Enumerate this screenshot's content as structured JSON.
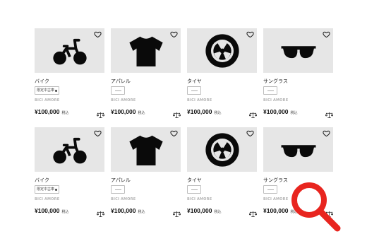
{
  "products": [
    {
      "icon": "bicycle-icon",
      "name": "バイク",
      "badge": "限定中古車",
      "badge_type": "tag",
      "brand": "BICI AMORE",
      "price": "¥100,000",
      "tax": "税込"
    },
    {
      "icon": "tshirt-icon",
      "name": "アパレル",
      "badge": "",
      "badge_type": "placeholder",
      "brand": "BICI AMORE",
      "price": "¥100,000",
      "tax": "税込"
    },
    {
      "icon": "tire-icon",
      "name": "タイヤ",
      "badge": "",
      "badge_type": "placeholder",
      "brand": "BICI AMORE",
      "price": "¥100,000",
      "tax": "税込"
    },
    {
      "icon": "sunglasses-icon",
      "name": "サングラス",
      "badge": "",
      "badge_type": "placeholder",
      "brand": "BICI AMORE",
      "price": "¥100,000",
      "tax": "税込"
    },
    {
      "icon": "bicycle-icon",
      "name": "バイク",
      "badge": "限定中古車",
      "badge_type": "tag",
      "brand": "BICI AMORE",
      "price": "¥100,000",
      "tax": "税込"
    },
    {
      "icon": "tshirt-icon",
      "name": "アパレル",
      "badge": "",
      "badge_type": "placeholder",
      "brand": "BICI AMORE",
      "price": "¥100,000",
      "tax": "税込"
    },
    {
      "icon": "tire-icon",
      "name": "タイヤ",
      "badge": "",
      "badge_type": "placeholder",
      "brand": "BICI AMORE",
      "price": "¥100,000",
      "tax": "税込"
    },
    {
      "icon": "sunglasses-icon",
      "name": "サングラス",
      "badge": "",
      "badge_type": "placeholder",
      "brand": "BICI AMORE",
      "price": "¥100,000",
      "tax": "税込"
    }
  ],
  "colors": {
    "thumb_bg": "#e6e6e6",
    "brand_text": "#b3b3b3",
    "search_overlay": "#e8251f"
  },
  "overlay_icon": "magnifier-icon"
}
